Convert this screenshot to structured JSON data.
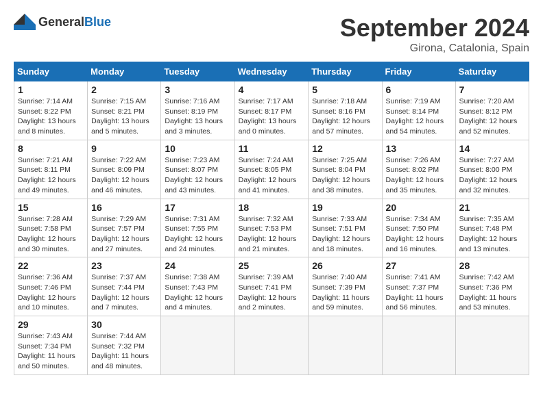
{
  "header": {
    "logo_general": "General",
    "logo_blue": "Blue",
    "month_year": "September 2024",
    "location": "Girona, Catalonia, Spain"
  },
  "days_of_week": [
    "Sunday",
    "Monday",
    "Tuesday",
    "Wednesday",
    "Thursday",
    "Friday",
    "Saturday"
  ],
  "weeks": [
    [
      {
        "day": "1",
        "sunrise": "Sunrise: 7:14 AM",
        "sunset": "Sunset: 8:22 PM",
        "daylight": "Daylight: 13 hours and 8 minutes."
      },
      {
        "day": "2",
        "sunrise": "Sunrise: 7:15 AM",
        "sunset": "Sunset: 8:21 PM",
        "daylight": "Daylight: 13 hours and 5 minutes."
      },
      {
        "day": "3",
        "sunrise": "Sunrise: 7:16 AM",
        "sunset": "Sunset: 8:19 PM",
        "daylight": "Daylight: 13 hours and 3 minutes."
      },
      {
        "day": "4",
        "sunrise": "Sunrise: 7:17 AM",
        "sunset": "Sunset: 8:17 PM",
        "daylight": "Daylight: 13 hours and 0 minutes."
      },
      {
        "day": "5",
        "sunrise": "Sunrise: 7:18 AM",
        "sunset": "Sunset: 8:16 PM",
        "daylight": "Daylight: 12 hours and 57 minutes."
      },
      {
        "day": "6",
        "sunrise": "Sunrise: 7:19 AM",
        "sunset": "Sunset: 8:14 PM",
        "daylight": "Daylight: 12 hours and 54 minutes."
      },
      {
        "day": "7",
        "sunrise": "Sunrise: 7:20 AM",
        "sunset": "Sunset: 8:12 PM",
        "daylight": "Daylight: 12 hours and 52 minutes."
      }
    ],
    [
      {
        "day": "8",
        "sunrise": "Sunrise: 7:21 AM",
        "sunset": "Sunset: 8:11 PM",
        "daylight": "Daylight: 12 hours and 49 minutes."
      },
      {
        "day": "9",
        "sunrise": "Sunrise: 7:22 AM",
        "sunset": "Sunset: 8:09 PM",
        "daylight": "Daylight: 12 hours and 46 minutes."
      },
      {
        "day": "10",
        "sunrise": "Sunrise: 7:23 AM",
        "sunset": "Sunset: 8:07 PM",
        "daylight": "Daylight: 12 hours and 43 minutes."
      },
      {
        "day": "11",
        "sunrise": "Sunrise: 7:24 AM",
        "sunset": "Sunset: 8:05 PM",
        "daylight": "Daylight: 12 hours and 41 minutes."
      },
      {
        "day": "12",
        "sunrise": "Sunrise: 7:25 AM",
        "sunset": "Sunset: 8:04 PM",
        "daylight": "Daylight: 12 hours and 38 minutes."
      },
      {
        "day": "13",
        "sunrise": "Sunrise: 7:26 AM",
        "sunset": "Sunset: 8:02 PM",
        "daylight": "Daylight: 12 hours and 35 minutes."
      },
      {
        "day": "14",
        "sunrise": "Sunrise: 7:27 AM",
        "sunset": "Sunset: 8:00 PM",
        "daylight": "Daylight: 12 hours and 32 minutes."
      }
    ],
    [
      {
        "day": "15",
        "sunrise": "Sunrise: 7:28 AM",
        "sunset": "Sunset: 7:58 PM",
        "daylight": "Daylight: 12 hours and 30 minutes."
      },
      {
        "day": "16",
        "sunrise": "Sunrise: 7:29 AM",
        "sunset": "Sunset: 7:57 PM",
        "daylight": "Daylight: 12 hours and 27 minutes."
      },
      {
        "day": "17",
        "sunrise": "Sunrise: 7:31 AM",
        "sunset": "Sunset: 7:55 PM",
        "daylight": "Daylight: 12 hours and 24 minutes."
      },
      {
        "day": "18",
        "sunrise": "Sunrise: 7:32 AM",
        "sunset": "Sunset: 7:53 PM",
        "daylight": "Daylight: 12 hours and 21 minutes."
      },
      {
        "day": "19",
        "sunrise": "Sunrise: 7:33 AM",
        "sunset": "Sunset: 7:51 PM",
        "daylight": "Daylight: 12 hours and 18 minutes."
      },
      {
        "day": "20",
        "sunrise": "Sunrise: 7:34 AM",
        "sunset": "Sunset: 7:50 PM",
        "daylight": "Daylight: 12 hours and 16 minutes."
      },
      {
        "day": "21",
        "sunrise": "Sunrise: 7:35 AM",
        "sunset": "Sunset: 7:48 PM",
        "daylight": "Daylight: 12 hours and 13 minutes."
      }
    ],
    [
      {
        "day": "22",
        "sunrise": "Sunrise: 7:36 AM",
        "sunset": "Sunset: 7:46 PM",
        "daylight": "Daylight: 12 hours and 10 minutes."
      },
      {
        "day": "23",
        "sunrise": "Sunrise: 7:37 AM",
        "sunset": "Sunset: 7:44 PM",
        "daylight": "Daylight: 12 hours and 7 minutes."
      },
      {
        "day": "24",
        "sunrise": "Sunrise: 7:38 AM",
        "sunset": "Sunset: 7:43 PM",
        "daylight": "Daylight: 12 hours and 4 minutes."
      },
      {
        "day": "25",
        "sunrise": "Sunrise: 7:39 AM",
        "sunset": "Sunset: 7:41 PM",
        "daylight": "Daylight: 12 hours and 2 minutes."
      },
      {
        "day": "26",
        "sunrise": "Sunrise: 7:40 AM",
        "sunset": "Sunset: 7:39 PM",
        "daylight": "Daylight: 11 hours and 59 minutes."
      },
      {
        "day": "27",
        "sunrise": "Sunrise: 7:41 AM",
        "sunset": "Sunset: 7:37 PM",
        "daylight": "Daylight: 11 hours and 56 minutes."
      },
      {
        "day": "28",
        "sunrise": "Sunrise: 7:42 AM",
        "sunset": "Sunset: 7:36 PM",
        "daylight": "Daylight: 11 hours and 53 minutes."
      }
    ],
    [
      {
        "day": "29",
        "sunrise": "Sunrise: 7:43 AM",
        "sunset": "Sunset: 7:34 PM",
        "daylight": "Daylight: 11 hours and 50 minutes."
      },
      {
        "day": "30",
        "sunrise": "Sunrise: 7:44 AM",
        "sunset": "Sunset: 7:32 PM",
        "daylight": "Daylight: 11 hours and 48 minutes."
      },
      null,
      null,
      null,
      null,
      null
    ]
  ]
}
